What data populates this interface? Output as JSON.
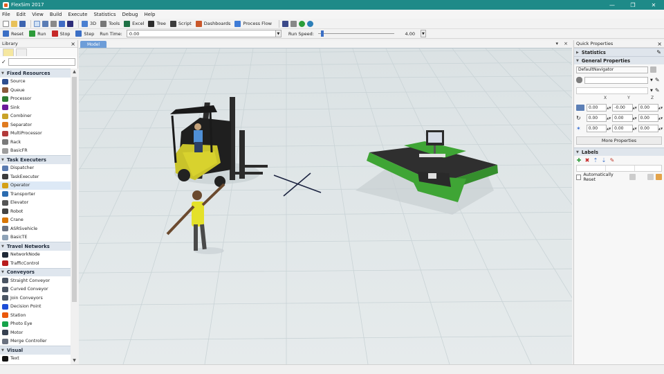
{
  "window": {
    "title": "FlexSim 2017",
    "minimize": "—",
    "maximize": "❐",
    "close": "✕"
  },
  "menu": [
    "File",
    "Edit",
    "View",
    "Build",
    "Execute",
    "Statistics",
    "Debug",
    "Help"
  ],
  "toolbar": {
    "view_3d": "3D",
    "tools": "Tools",
    "excel": "Excel",
    "tree": "Tree",
    "script": "Script",
    "dashboards": "Dashboards",
    "process_flow": "Process Flow"
  },
  "runbar": {
    "reset": "Reset",
    "run": "Run",
    "stop": "Stop",
    "step": "Step",
    "run_time_label": "Run Time:",
    "run_time_value": "0.00",
    "run_speed_label": "Run Speed:",
    "run_speed_value": "4.00"
  },
  "library": {
    "title": "Library",
    "filter_placeholder": "",
    "groups": [
      {
        "name": "Fixed Resources",
        "items": [
          {
            "label": "Source",
            "color": "#2f4f8f"
          },
          {
            "label": "Queue",
            "color": "#8b5a3c"
          },
          {
            "label": "Processor",
            "color": "#2e7d32"
          },
          {
            "label": "Sink",
            "color": "#6a1b9a"
          },
          {
            "label": "Combiner",
            "color": "#c9a227"
          },
          {
            "label": "Separator",
            "color": "#e07b1f"
          },
          {
            "label": "MultiProcessor",
            "color": "#b23a3a"
          },
          {
            "label": "Rack",
            "color": "#7a7a7a"
          },
          {
            "label": "BasicFR",
            "color": "#9e9e9e"
          }
        ]
      },
      {
        "name": "Task Executers",
        "items": [
          {
            "label": "Dispatcher",
            "color": "#5a7bb0"
          },
          {
            "label": "TaskExecuter",
            "color": "#3c3c3c"
          },
          {
            "label": "Operator",
            "color": "#d4a017"
          },
          {
            "label": "Transporter",
            "color": "#2b6cb0"
          },
          {
            "label": "Elevator",
            "color": "#555555"
          },
          {
            "label": "Robot",
            "color": "#444444"
          },
          {
            "label": "Crane",
            "color": "#d97706"
          },
          {
            "label": "ASRSvehicle",
            "color": "#6b7280"
          },
          {
            "label": "BasicTE",
            "color": "#8fa3b8"
          }
        ]
      },
      {
        "name": "Travel Networks",
        "items": [
          {
            "label": "NetworkNode",
            "color": "#1f2937"
          },
          {
            "label": "TrafficControl",
            "color": "#b91c1c"
          }
        ]
      },
      {
        "name": "Conveyors",
        "items": [
          {
            "label": "Straight Conveyor",
            "color": "#4b5563"
          },
          {
            "label": "Curved Conveyor",
            "color": "#4b5563"
          },
          {
            "label": "Join Conveyors",
            "color": "#4b5563"
          },
          {
            "label": "Decision Point",
            "color": "#1d4ed8"
          },
          {
            "label": "Station",
            "color": "#ea580c"
          },
          {
            "label": "Photo Eye",
            "color": "#16a34a"
          },
          {
            "label": "Motor",
            "color": "#374151"
          },
          {
            "label": "Merge Controller",
            "color": "#6b7280"
          }
        ]
      },
      {
        "name": "Visual",
        "items": [
          {
            "label": "Text",
            "color": "#111111"
          }
        ]
      }
    ]
  },
  "viewport": {
    "tab": "Model"
  },
  "quick_properties": {
    "title": "Quick Properties",
    "statistics": "Statistics",
    "general_properties": "General Properties",
    "object_name": "DefaultNavigator",
    "axes": [
      "X",
      "Y",
      "Z"
    ],
    "position": [
      "0.00",
      "-0.00",
      "0.00"
    ],
    "rotation": [
      "0.00",
      "0.00",
      "0.00"
    ],
    "size": [
      "0.00",
      "0.00",
      "0.00"
    ],
    "more_properties": "More Properties",
    "labels": "Labels",
    "auto_reset": "Automatically Reset"
  }
}
